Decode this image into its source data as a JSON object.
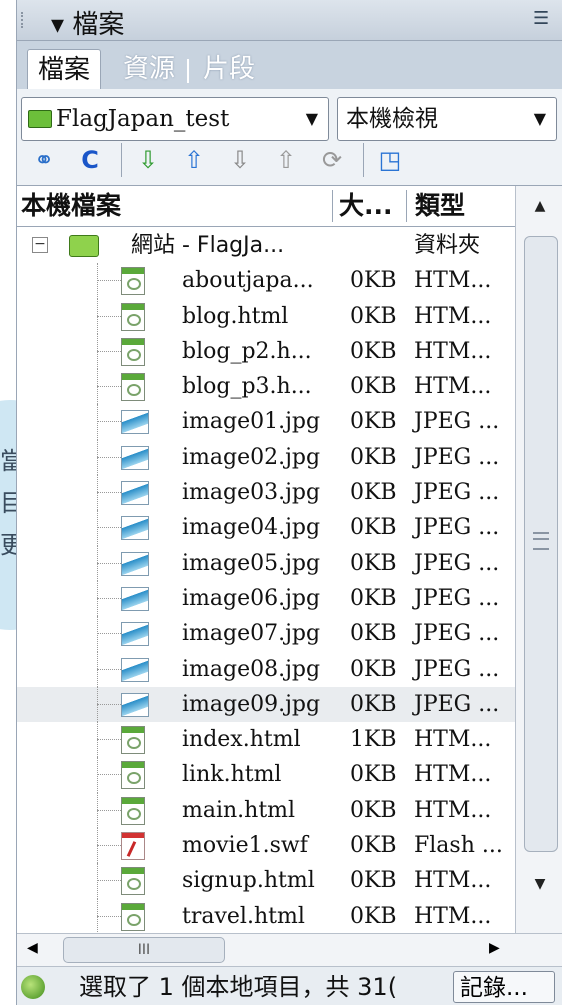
{
  "bubble": {
    "lines": [
      "當",
      "目",
      "更"
    ]
  },
  "panel": {
    "title": "▾ 檔案",
    "tabs": [
      {
        "label": "檔案",
        "active": true
      },
      {
        "label": "資源",
        "active": false
      },
      {
        "label": "片段",
        "active": false
      }
    ]
  },
  "controls": {
    "site_select": "FlagJapan_test",
    "view_select": "本機檢視",
    "toolbar_icons": [
      "connect-icon",
      "refresh-icon",
      "get-icon",
      "put-icon",
      "check-out-icon",
      "check-in-icon",
      "synchronize-icon",
      "expand-icon"
    ]
  },
  "columns": {
    "name": "本機檔案",
    "size": "大...",
    "type": "類型"
  },
  "root": {
    "name": "網站 - FlagJa...",
    "type": "資料夾"
  },
  "files": [
    {
      "name": "aboutjapa...",
      "size": "0KB",
      "type": "HTM...",
      "icon": "html"
    },
    {
      "name": "blog.html",
      "size": "0KB",
      "type": "HTM...",
      "icon": "html"
    },
    {
      "name": "blog_p2.h...",
      "size": "0KB",
      "type": "HTM...",
      "icon": "html"
    },
    {
      "name": "blog_p3.h...",
      "size": "0KB",
      "type": "HTM...",
      "icon": "html"
    },
    {
      "name": "image01.jpg",
      "size": "0KB",
      "type": "JPEG ...",
      "icon": "jpg"
    },
    {
      "name": "image02.jpg",
      "size": "0KB",
      "type": "JPEG ...",
      "icon": "jpg"
    },
    {
      "name": "image03.jpg",
      "size": "0KB",
      "type": "JPEG ...",
      "icon": "jpg"
    },
    {
      "name": "image04.jpg",
      "size": "0KB",
      "type": "JPEG ...",
      "icon": "jpg"
    },
    {
      "name": "image05.jpg",
      "size": "0KB",
      "type": "JPEG ...",
      "icon": "jpg"
    },
    {
      "name": "image06.jpg",
      "size": "0KB",
      "type": "JPEG ...",
      "icon": "jpg"
    },
    {
      "name": "image07.jpg",
      "size": "0KB",
      "type": "JPEG ...",
      "icon": "jpg"
    },
    {
      "name": "image08.jpg",
      "size": "0KB",
      "type": "JPEG ...",
      "icon": "jpg"
    },
    {
      "name": "image09.jpg",
      "size": "0KB",
      "type": "JPEG ...",
      "icon": "jpg",
      "selected": true
    },
    {
      "name": "index.html",
      "size": "1KB",
      "type": "HTM...",
      "icon": "html"
    },
    {
      "name": "link.html",
      "size": "0KB",
      "type": "HTM...",
      "icon": "html"
    },
    {
      "name": "main.html",
      "size": "0KB",
      "type": "HTM...",
      "icon": "html"
    },
    {
      "name": "movie1.swf",
      "size": "0KB",
      "type": "Flash ...",
      "icon": "swf"
    },
    {
      "name": "signup.html",
      "size": "0KB",
      "type": "HTM...",
      "icon": "html"
    },
    {
      "name": "travel.html",
      "size": "0KB",
      "type": "HTM...",
      "icon": "html"
    }
  ],
  "hscroll": {
    "thumb_label": "III"
  },
  "status": {
    "text": "選取了 1 個本地項目，共 31(",
    "log_button": "記錄..."
  }
}
